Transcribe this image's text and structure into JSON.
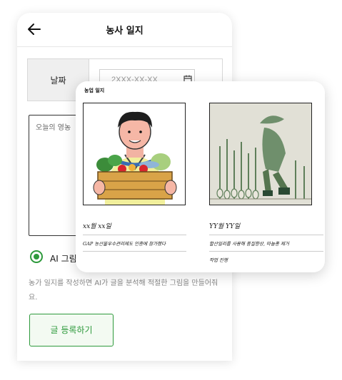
{
  "header": {
    "title": "농사 일지",
    "back_icon": "arrow-left-icon"
  },
  "form": {
    "date_label": "날짜",
    "date_placeholder": "2XXX-XX-XX",
    "content_placeholder": "오늘의 영농",
    "ai_option_label": "AI 그림",
    "ai_description": "농가 일지를 작성하면 AI가 글을 분석해 적절한 그림을 만들어줘요.",
    "submit_label": "글 등록하기"
  },
  "preview": {
    "title": "농업 일지",
    "entries": [
      {
        "date": "xx월 xx일",
        "lines": [
          "GAP 농산물우수관리제도 인증에 참가했다"
        ]
      },
      {
        "date": "YY월 YY일",
        "lines": [
          "할산일리를 사용해 품질향상, 마늘종 제거",
          "작업 진행"
        ]
      }
    ]
  },
  "colors": {
    "accent": "#2e9a3c",
    "border": "#d8d8d8"
  }
}
